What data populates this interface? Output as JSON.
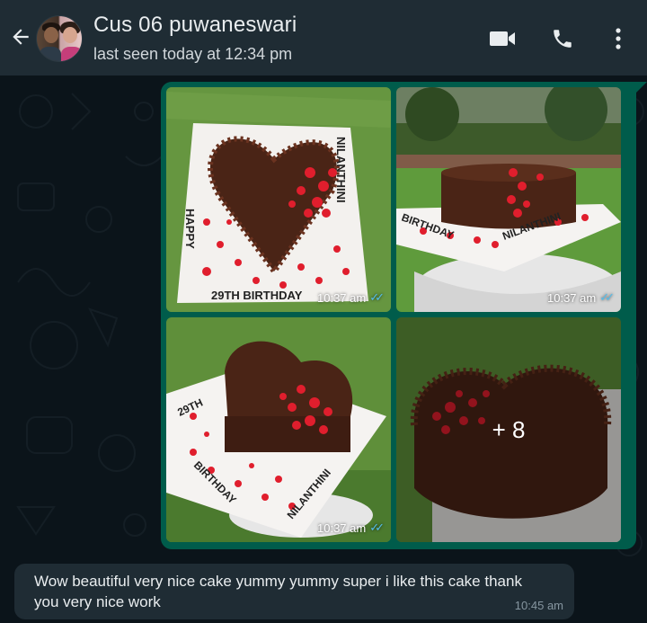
{
  "header": {
    "contact_name": "Cus 06 puwaneswari",
    "last_seen": "last seen today at 12:34 pm",
    "icons": {
      "back": "arrow-left-icon",
      "video": "video-camera-icon",
      "call": "phone-icon",
      "menu": "more-vertical-icon"
    }
  },
  "colors": {
    "header_bg": "#1f2c34",
    "chat_bg": "#0b141a",
    "outgoing_bubble": "#005c4b",
    "incoming_bubble": "#1f2c34",
    "read_ticks": "#53bdeb"
  },
  "media_message": {
    "photos": [
      {
        "caption": "HAPPY 29TH BIRTHDAY NILANTHINI",
        "time": "10:37 am"
      },
      {
        "caption": "HAPPY BIRTHDAY",
        "time": "10:37 am"
      },
      {
        "caption": "29TH BIRTHDAY",
        "time": "10:37 am"
      },
      {
        "caption": "",
        "time": ""
      }
    ],
    "more_count": "+ 8"
  },
  "incoming_message": {
    "text": "Wow beautiful very nice cake yummy yummy super i like this cake thank you very nice work",
    "time": "10:45 am"
  }
}
